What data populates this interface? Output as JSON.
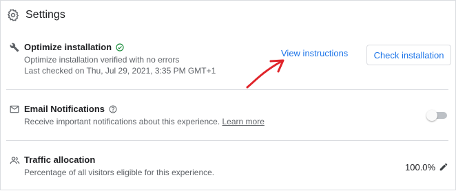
{
  "header": {
    "title": "Settings",
    "icon": "gear-icon"
  },
  "optimize": {
    "title": "Optimize installation",
    "status_icon": "check-circle-icon",
    "sub1": "Optimize installation verified with no errors",
    "sub2": "Last checked on Thu, Jul 29, 2021, 3:35 PM GMT+1",
    "view_label": "View instructions",
    "check_label": "Check installation",
    "icon": "wrench-icon"
  },
  "email": {
    "title": "Email Notifications",
    "help_icon": "help-circle-icon",
    "sub": "Receive important notifications about this experience.",
    "learn_more": "Learn more",
    "toggle_on": false,
    "icon": "mail-icon"
  },
  "traffic": {
    "title": "Traffic allocation",
    "sub": "Percentage of all visitors eligible for this experience.",
    "value": "100.0%",
    "icon": "people-icon",
    "edit_icon": "pencil-icon"
  },
  "annotation": {
    "arrow_color": "#e0242a"
  }
}
